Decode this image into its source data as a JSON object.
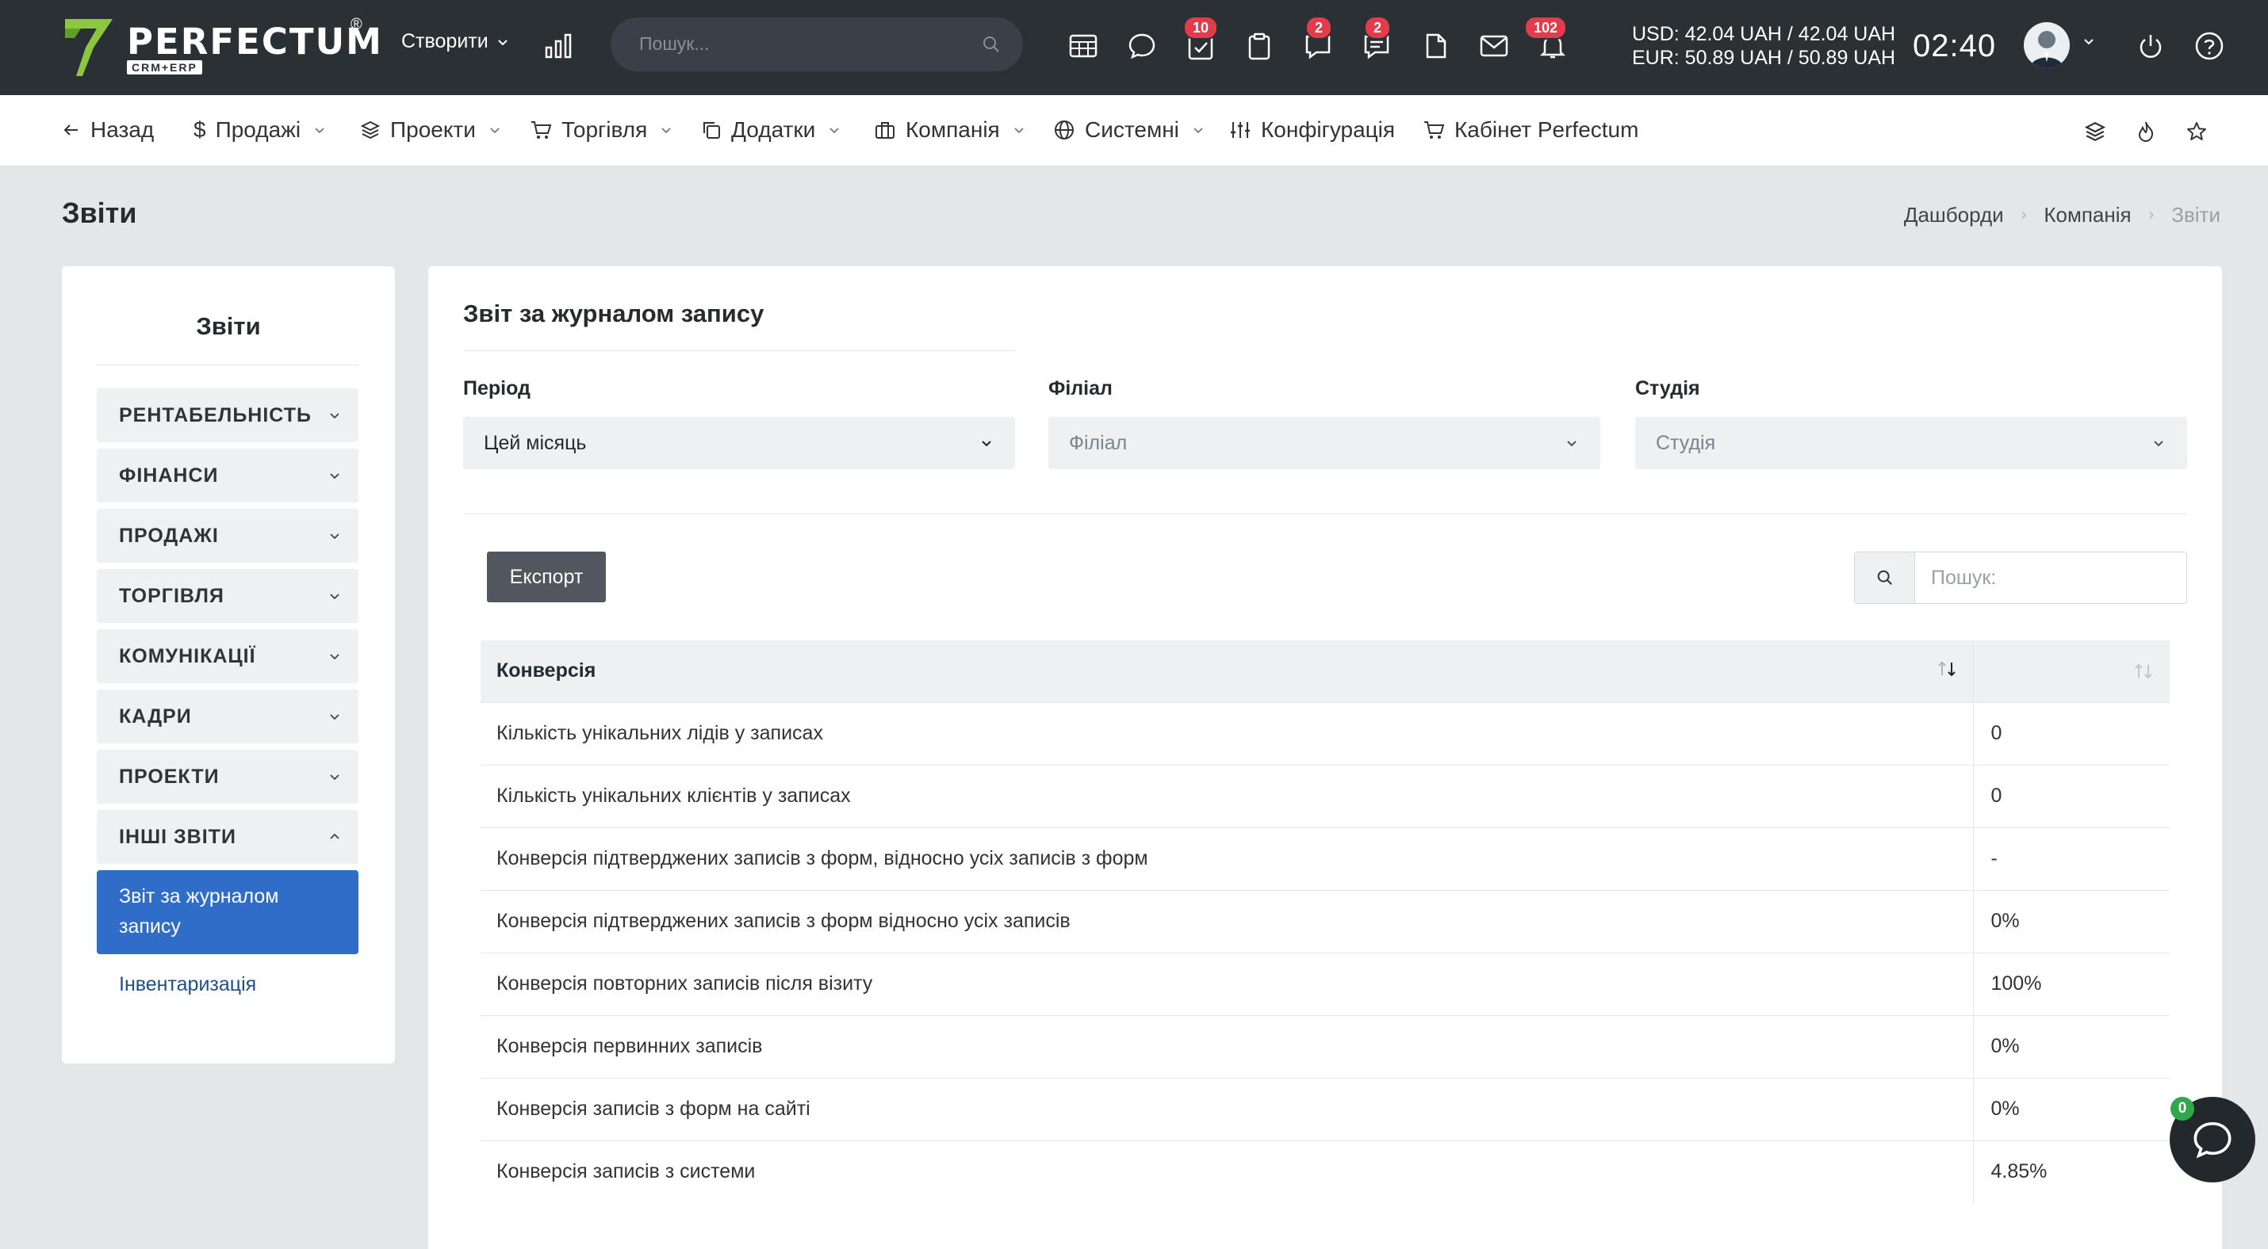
{
  "brand": {
    "name": "PERFECTUM",
    "reg": "®",
    "sub": "CRM+ERP"
  },
  "topbar": {
    "create_label": "Створити",
    "search_placeholder": "Пошук...",
    "badges": {
      "tasks": "10",
      "chat": "2",
      "comments": "2",
      "notifications": "102"
    },
    "currency_usd": "USD: 42.04 UAH / 42.04 UAH",
    "currency_eur": "EUR: 50.89 UAH / 50.89 UAH",
    "time": "02:40"
  },
  "nav": {
    "back": "Назад",
    "sales": "Продажі",
    "projects": "Проекти",
    "trade": "Торгівля",
    "addons": "Додатки",
    "company": "Компанія",
    "system": "Системні",
    "config": "Конфігурація",
    "cabinet": "Кабінет Perfectum"
  },
  "page": {
    "title": "Звіти"
  },
  "breadcrumb": [
    "Дашборди",
    "Компанія",
    "Звіти"
  ],
  "sidebar": {
    "title": "Звіти",
    "items": [
      "РЕНТАБЕЛЬНІСТЬ",
      "ФІНАНСИ",
      "ПРОДАЖІ",
      "ТОРГІВЛЯ",
      "КОМУНІКАЦІЇ",
      "КАДРИ",
      "ПРОЕКТИ",
      "ІНШІ ЗВІТИ"
    ],
    "active_sub": "Звіт за журналом запису",
    "sub_link": "Інвентаризація"
  },
  "report": {
    "title": "Звіт за журналом запису",
    "filters": {
      "period_label": "Період",
      "period_value": "Цей місяць",
      "branch_label": "Філіал",
      "branch_placeholder": "Філіал",
      "studio_label": "Студія",
      "studio_placeholder": "Студія"
    },
    "export_label": "Експорт",
    "search_placeholder": "Пошук:",
    "table": {
      "headers": [
        "Конверсія",
        ""
      ],
      "rows": [
        {
          "label": "Кількість унікальних лідів у записах",
          "value": "0"
        },
        {
          "label": "Кількість унікальних клієнтів у записах",
          "value": "0"
        },
        {
          "label": "Конверсія підтверджених записів з форм, відносно усіх записів з форм",
          "value": "-"
        },
        {
          "label": "Конверсія підтверджених записів з форм відносно усіх записів",
          "value": "0%"
        },
        {
          "label": "Конверсія повторних записів після візиту",
          "value": "100%"
        },
        {
          "label": "Конверсія первинних записів",
          "value": "0%"
        },
        {
          "label": "Конверсія записів з форм на сайті",
          "value": "0%"
        },
        {
          "label": "Конверсія записів з системи",
          "value": "4.85%"
        }
      ]
    }
  },
  "chat": {
    "badge": "0"
  },
  "colors": {
    "topbar": "#2b3035",
    "accent": "#2f6dc9",
    "badge": "#e23b4b",
    "logo_green": "#8dc63f"
  }
}
